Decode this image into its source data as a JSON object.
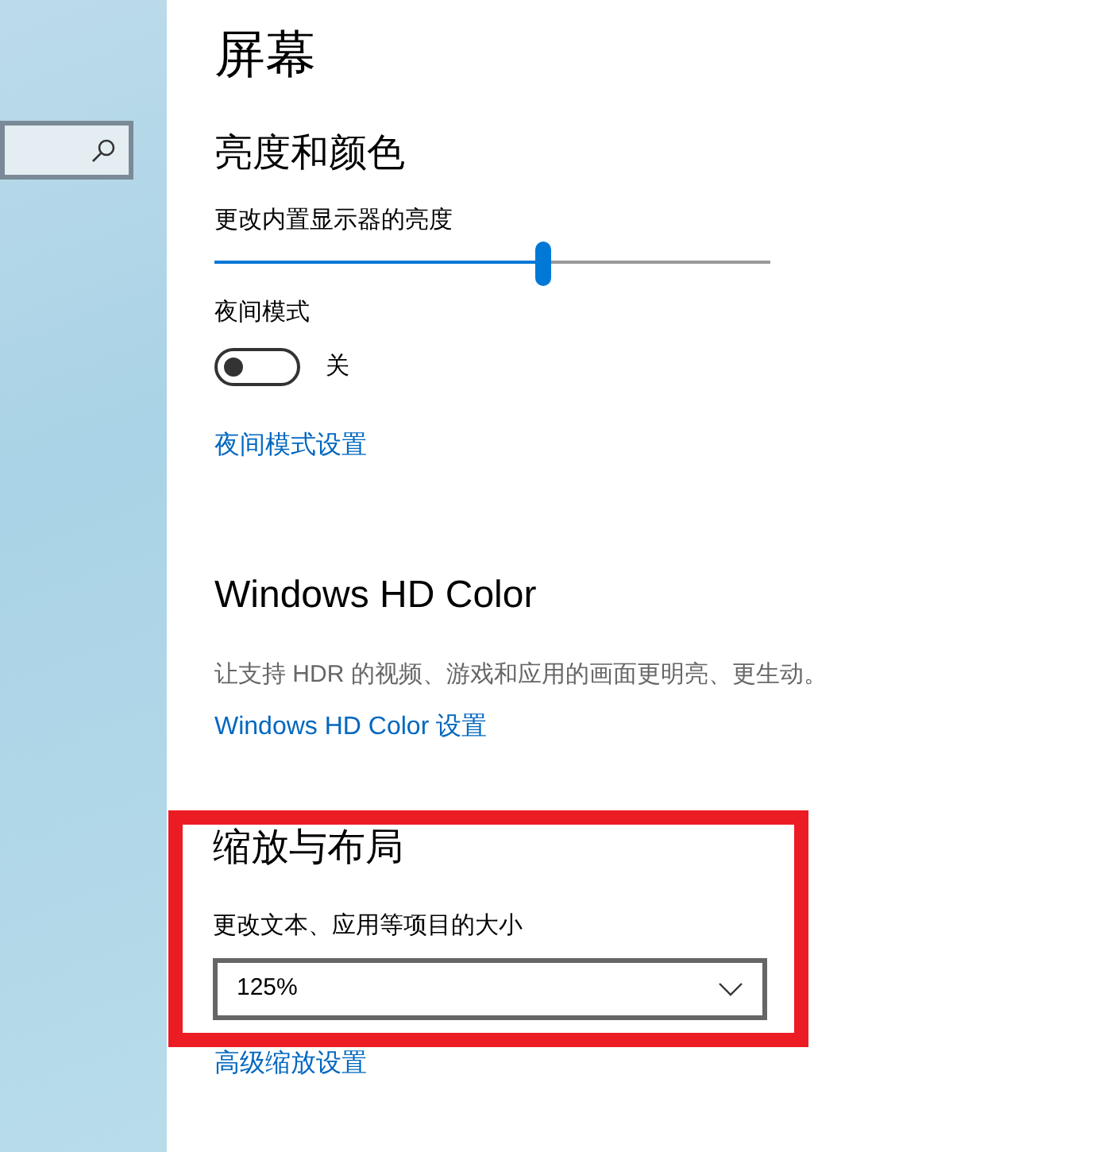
{
  "page_title": "屏幕",
  "brightness": {
    "heading": "亮度和颜色",
    "slider_label": "更改内置显示器的亮度",
    "level": 0.59,
    "night_mode_label": "夜间模式",
    "night_mode_on": false,
    "night_mode_state": "关",
    "night_mode_link": "夜间模式设置"
  },
  "hdr": {
    "heading": "Windows HD Color",
    "description": "让支持 HDR 的视频、游戏和应用的画面更明亮、更生动。",
    "link": "Windows HD Color 设置"
  },
  "scale": {
    "highlighted": true,
    "heading": "缩放与布局",
    "dropdown_label": "更改文本、应用等项目的大小",
    "dropdown_value": "125%",
    "link": "高级缩放设置"
  }
}
